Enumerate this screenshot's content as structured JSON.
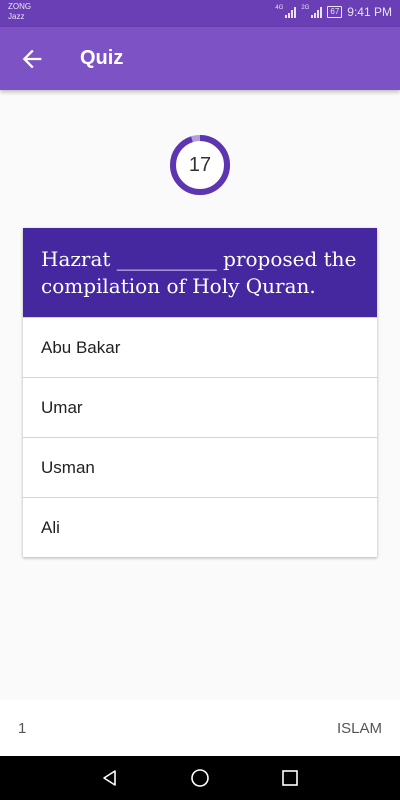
{
  "status_bar": {
    "carrier_1": "ZONG",
    "carrier_2": "Jazz",
    "network_1": "4G",
    "network_2": "2G",
    "battery": "67",
    "time": "9:41 PM"
  },
  "app_bar": {
    "title": "Quiz",
    "back_icon": "arrow-back-icon"
  },
  "timer": {
    "value": "17",
    "progress_fraction": 0.95,
    "ring_color": "#5e35b1",
    "track_color": "#b39ddb"
  },
  "question": {
    "text": "Hazrat __________ proposed the compilation of Holy Quran."
  },
  "options": [
    {
      "label": "Abu Bakar"
    },
    {
      "label": "Umar"
    },
    {
      "label": "Usman"
    },
    {
      "label": "Ali"
    }
  ],
  "footer": {
    "question_number": "1",
    "category": "ISLAM"
  },
  "nav_bar": {
    "back": "triangle-back-icon",
    "home": "circle-home-icon",
    "recents": "square-recents-icon"
  },
  "colors": {
    "status_bar": "#6a3fb5",
    "app_bar": "#7c52c5",
    "question_bg": "#4527a0"
  }
}
